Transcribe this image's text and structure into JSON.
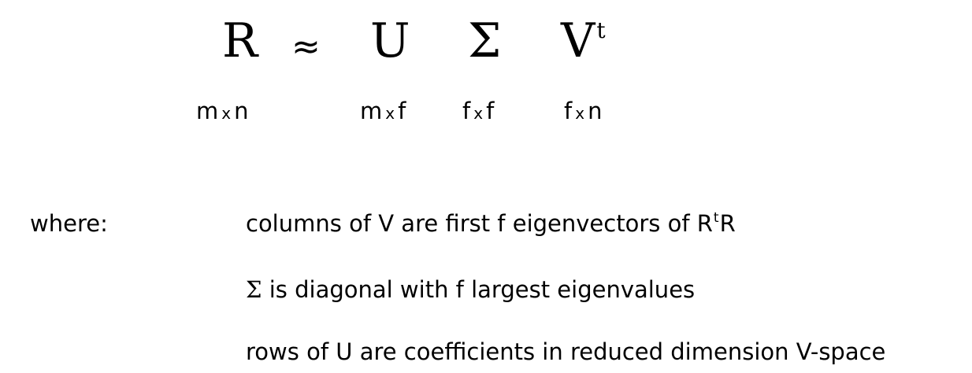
{
  "equation": {
    "lhs": "R",
    "approx": "≈",
    "u": "U",
    "sigma": "Σ",
    "v": "V",
    "v_superscript": "t"
  },
  "dimensions": {
    "r": {
      "rows": "m",
      "times": "x",
      "cols": "n"
    },
    "u": {
      "rows": "m",
      "times": "x",
      "cols": "f"
    },
    "sigma": {
      "rows": "f",
      "times": "x",
      "cols": "f"
    },
    "v": {
      "rows": "f",
      "times": "x",
      "cols": "n"
    }
  },
  "where": {
    "label": "where:",
    "line1": {
      "text": "columns of V are first f eigenvectors of R",
      "sup": "t",
      "tail": "R"
    },
    "line2": {
      "sigma": "Σ",
      "text": " is diagonal with f largest eigenvalues"
    },
    "line3": {
      "text": "rows of U are coefficients in reduced dimension V-space"
    }
  }
}
